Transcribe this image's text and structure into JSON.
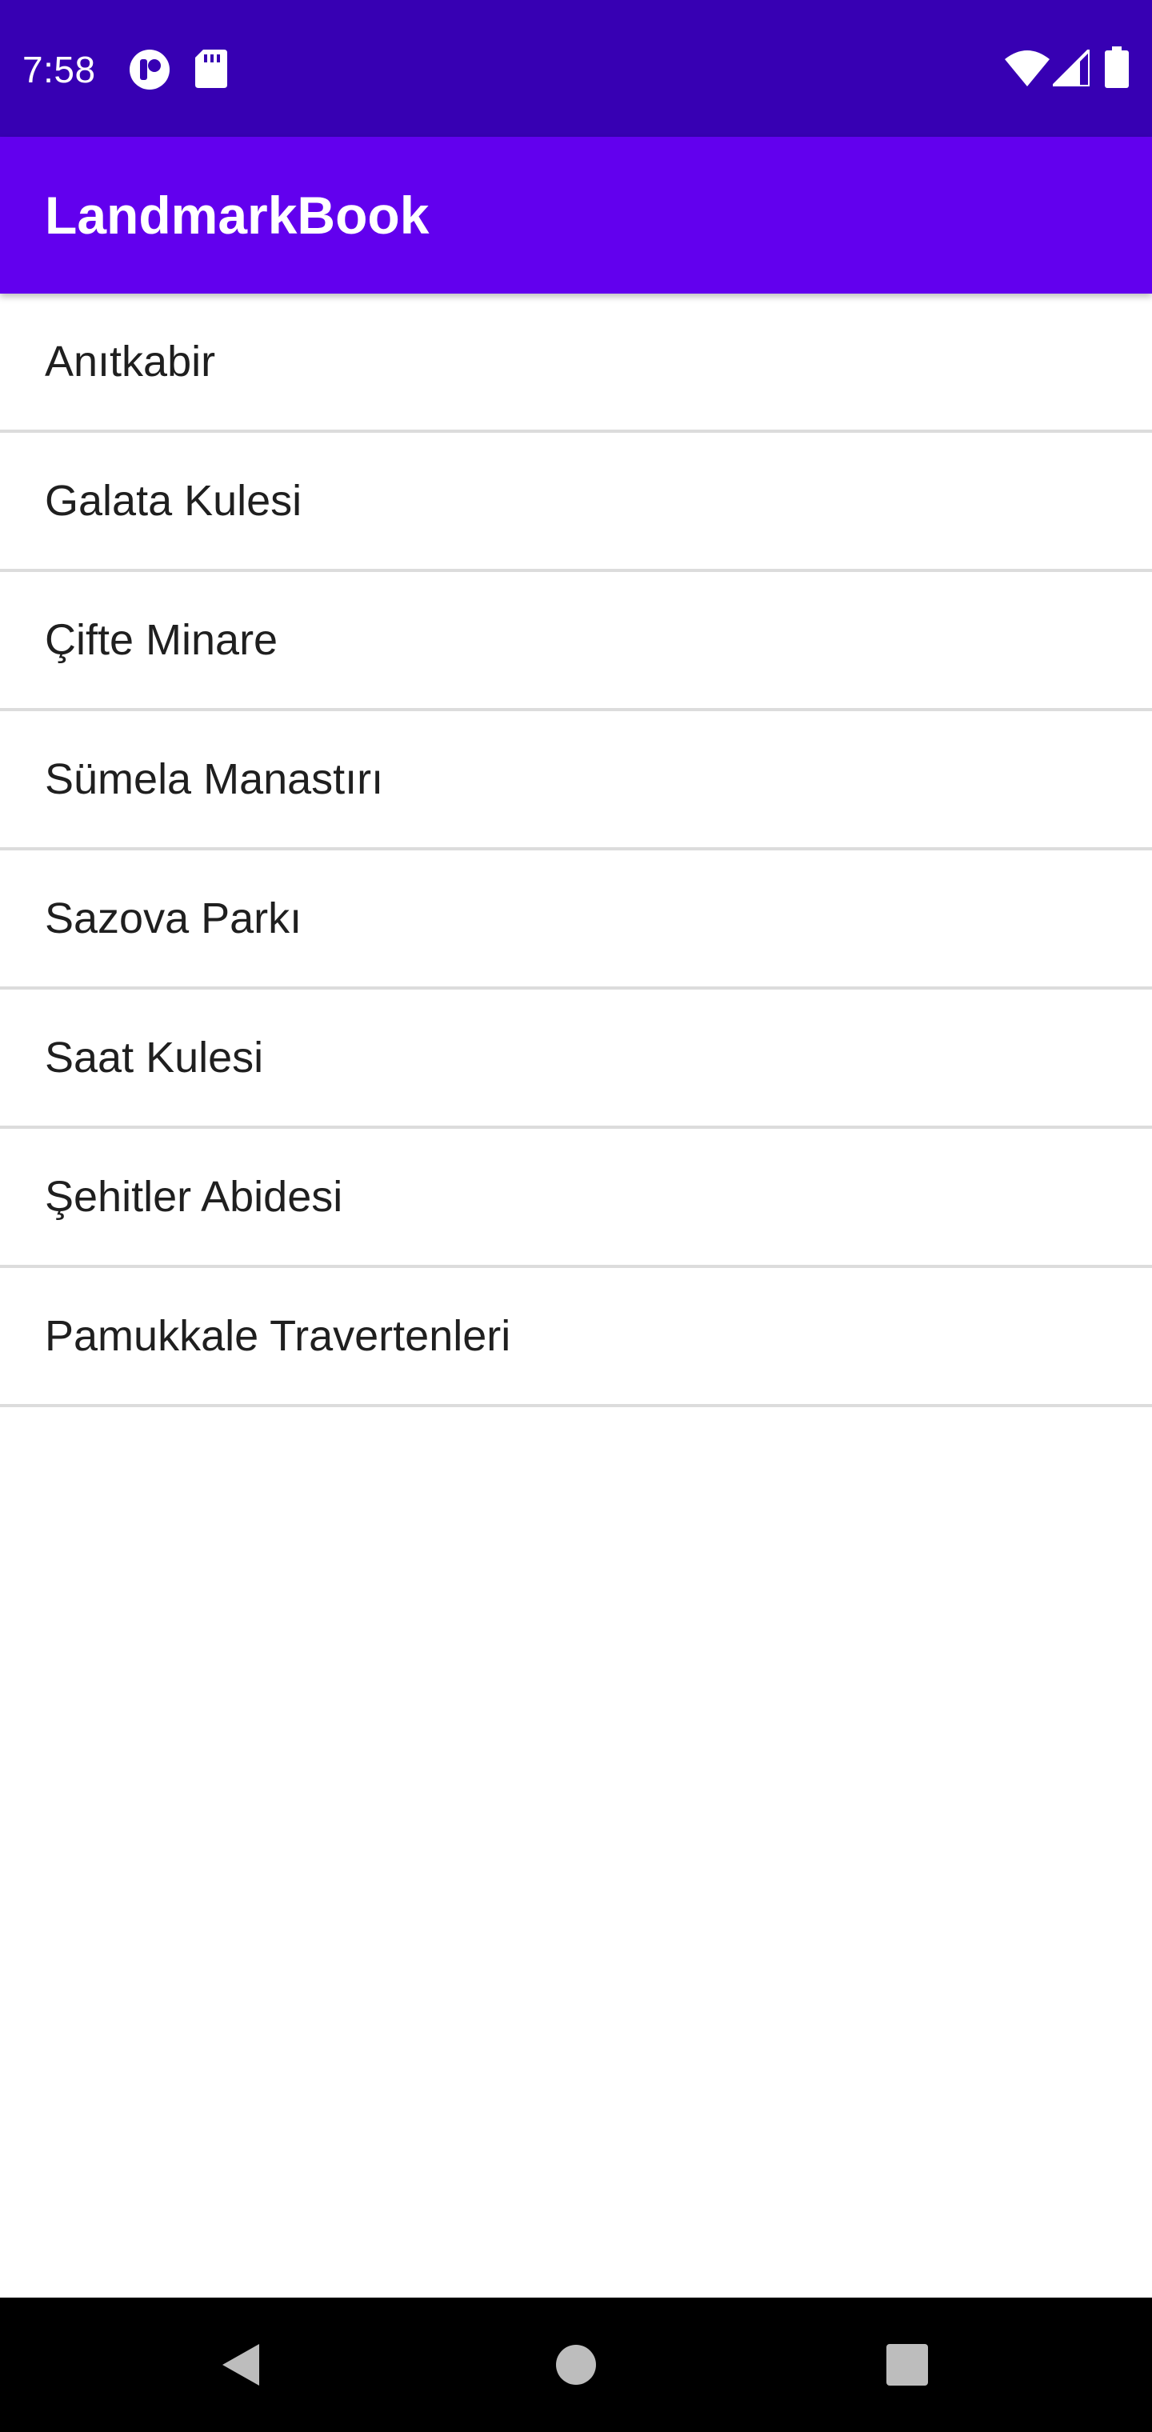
{
  "status_bar": {
    "time": "7:58",
    "icons": [
      "app-notification-icon",
      "sd-card-icon",
      "wifi-icon",
      "signal-icon",
      "battery-icon"
    ],
    "background": "#3700b3"
  },
  "app_bar": {
    "title": "LandmarkBook",
    "background": "#6200ee"
  },
  "landmarks": [
    {
      "label": "Anıtkabir"
    },
    {
      "label": "Galata Kulesi"
    },
    {
      "label": "Çifte Minare"
    },
    {
      "label": "Sümela Manastırı"
    },
    {
      "label": "Sazova Parkı"
    },
    {
      "label": "Saat Kulesi"
    },
    {
      "label": "Şehitler Abidesi"
    },
    {
      "label": "Pamukkale Travertenleri"
    }
  ],
  "nav_bar": {
    "buttons": [
      "back-icon",
      "home-icon",
      "recents-icon"
    ],
    "background": "#000000"
  }
}
